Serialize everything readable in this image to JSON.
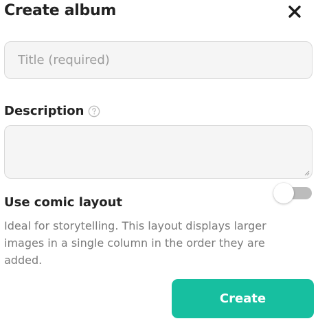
{
  "dialog": {
    "title": "Create album",
    "close_icon": "close-icon"
  },
  "form": {
    "title_field": {
      "placeholder": "Title (required)",
      "value": ""
    },
    "description": {
      "label": "Description",
      "help_icon": "question-circle-icon",
      "value": ""
    },
    "comic_layout": {
      "label": "Use comic layout",
      "enabled": false,
      "helper_text": "Ideal for storytelling. This layout displays larger images in a single column in the order they are added."
    },
    "create_button": {
      "label": "Create"
    }
  },
  "colors": {
    "accent": "#17bfa0",
    "field_background": "#f5f5f5",
    "field_border": "#d9d9d9",
    "toggle_off_track": "#bcbcbc",
    "helper_text": "#7a7a7a"
  }
}
